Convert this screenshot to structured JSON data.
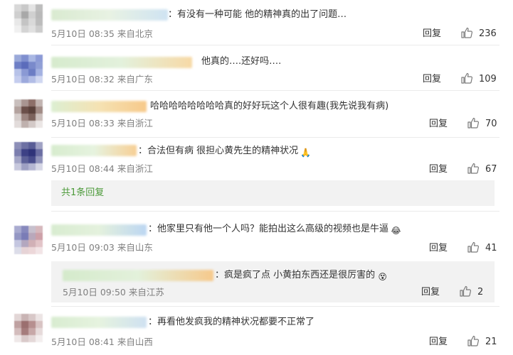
{
  "comments": [
    {
      "text": "：有没有一种可能 他的精神真的出了问题…",
      "time": "5月10日 08:35",
      "location": "来自北京",
      "reply_label": "回复",
      "likes": "236",
      "avatar_colors": [
        "#d8d8d8",
        "#c9c9c9",
        "#e4e4e4",
        "#bdbdbd",
        "#cfcfcf",
        "#a8a8a8",
        "#d0d0d0",
        "#b9b9b9",
        "#e8e8e8",
        "#c4c4c4",
        "#d9d9d9",
        "#bcbcbc",
        "#f0f0f0",
        "#d4d4d4",
        "#e0e0e0",
        "#cccccc"
      ],
      "name_colors": [
        "#d9ead0",
        "#e8f2e3",
        "#cfe3f2"
      ]
    },
    {
      "text": "他真的….还好吗….",
      "time": "5月10日 08:32",
      "location": "来自广东",
      "reply_label": "回复",
      "likes": "109",
      "avatar_colors": [
        "#9aa9d9",
        "#7f8fcf",
        "#a9b7e3",
        "#8c9ad6",
        "#6e7fc6",
        "#5b6cbb",
        "#7a8acb",
        "#909fd6",
        "#b7c2e8",
        "#8a99d4",
        "#6c7dc4",
        "#a3b1e1",
        "#c5cdee",
        "#9ca9dc",
        "#b2bde6",
        "#d0d7f1"
      ],
      "name_colors": [
        "#d6ebcd",
        "#e3f1dc",
        "#f7d9a6"
      ]
    },
    {
      "text": "哈哈哈哈哈哈哈哈真的好好玩这个人很有趣(我先说我有病)",
      "time": "5月10日 08:33",
      "location": "来自浙江",
      "reply_label": "回复",
      "likes": "70",
      "avatar_colors": [
        "#c9bfbd",
        "#a99591",
        "#8d6f69",
        "#c2b4b1",
        "#b3a29e",
        "#6b4f49",
        "#5a413b",
        "#a18b86",
        "#d6cecc",
        "#9c8580",
        "#7c625c",
        "#cbbfbc",
        "#e2dcdb",
        "#bfb1ae",
        "#d3c9c7",
        "#ebe6e5"
      ],
      "name_colors": [
        "#dcefd2",
        "#f5e2b3",
        "#f7c98a"
      ]
    },
    {
      "text": "：合法但有病 很担心黄先生的精神状况",
      "emoji": "🙏",
      "time": "5月10日 08:44",
      "location": "来自浙江",
      "reply_label": "回复",
      "likes": "67",
      "avatar_colors": [
        "#8d8fb8",
        "#6d70a3",
        "#595d96",
        "#9fa1c4",
        "#7b7eae",
        "#3d4185",
        "#2f3379",
        "#6a6da2",
        "#a4a6c7",
        "#5d6198",
        "#484c8c",
        "#8f92ba",
        "#c7c8dd",
        "#9ea0c3",
        "#b4b6d2",
        "#d6d7e6"
      ],
      "name_colors": [
        "#d7ecce",
        "#e6f3df",
        "#f7cf95"
      ],
      "more_replies": "共1条回复"
    },
    {
      "text": "：他家里只有他一个人吗？能拍出这么高级的视频也是牛逼",
      "emoji": "😂",
      "time": "5月10日 09:03",
      "location": "来自山东",
      "reply_label": "回复",
      "likes": "41",
      "avatar_colors": [
        "#a9abd0",
        "#8789bd",
        "#c7c0cd",
        "#d6b8bd",
        "#9497c4",
        "#7a7cb6",
        "#b9a8bb",
        "#cda0a8",
        "#c4c6e0",
        "#b3a7bf",
        "#d1b0b6",
        "#e2c4c8",
        "#dcdde9",
        "#e6d3d6",
        "#ecd7d9",
        "#f2e4e6"
      ],
      "name_colors": [
        "#d8ecd0",
        "#e4f1dd",
        "#bcd6f2"
      ]
    }
  ],
  "sub_reply": {
    "text": "：疯是疯了点 小黄拍东西还是很厉害的",
    "emoji": "😵",
    "time": "5月10日 09:50",
    "location": "来自江苏",
    "reply_label": "回复",
    "likes": "2",
    "name_colors": [
      "#d4eacb",
      "#e3f1db",
      "#f6c98c"
    ]
  },
  "last_comment": {
    "text": "：再看他发疯我的精神状况都要不正常了",
    "time": "5月10日 08:41",
    "location": "来自山西",
    "reply_label": "回复",
    "likes": "21",
    "avatar_colors": [
      "#e2d6d6",
      "#c9b4b4",
      "#d8c8c8",
      "#ece4e4",
      "#bfa1a1",
      "#9b6f6f",
      "#b68f8f",
      "#d8c3c3",
      "#d3bcbc",
      "#a57c7c",
      "#c7a8a8",
      "#e6dada",
      "#efe8e8",
      "#d9caca",
      "#e4d8d8",
      "#f3eeee"
    ],
    "name_colors": [
      "#d8ecd0",
      "#e6f3df",
      "#cfe1f1"
    ]
  },
  "accent_color": "#4c9a3a"
}
